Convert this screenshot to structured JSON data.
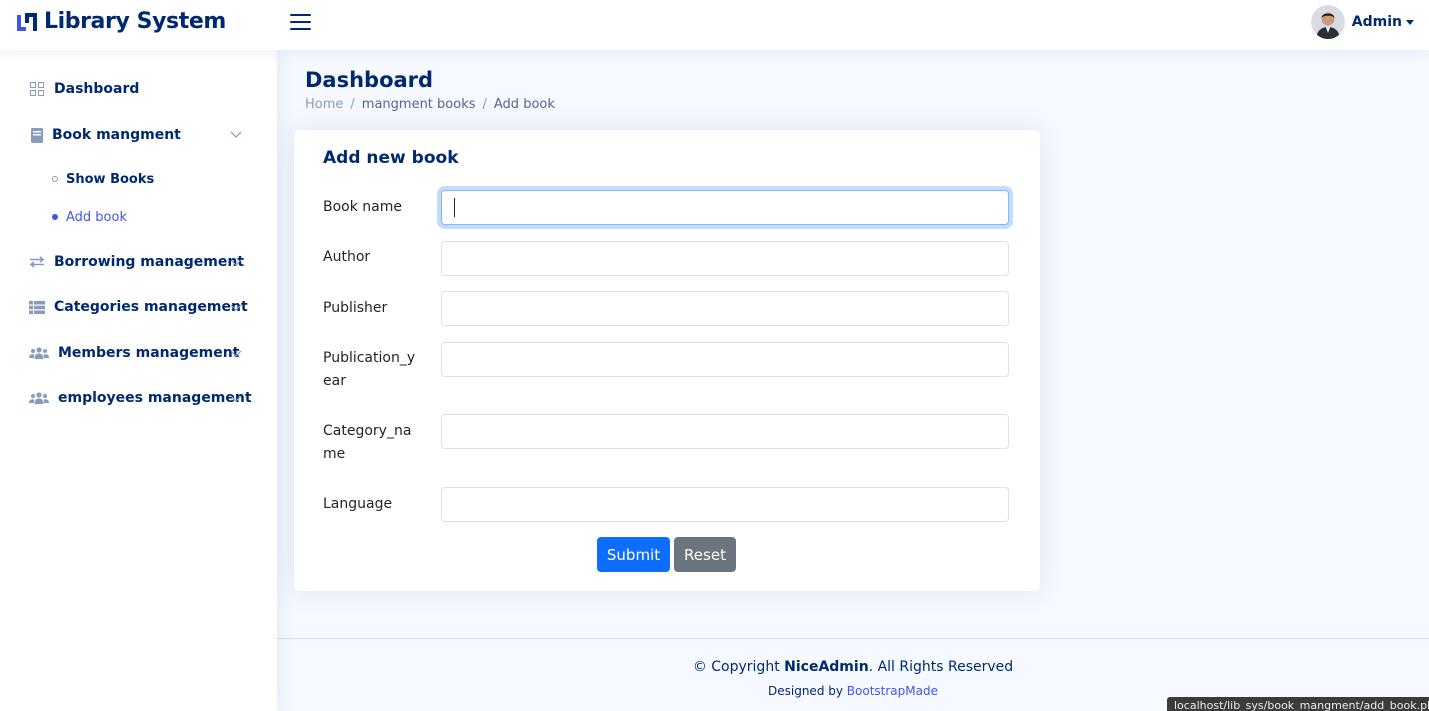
{
  "header": {
    "app_title": "Library System",
    "profile_name": "Admin"
  },
  "sidebar": {
    "items": [
      {
        "label": "Dashboard",
        "icon": "grid-icon"
      },
      {
        "label": "Book mangment",
        "icon": "book-icon"
      },
      {
        "label": "Borrowing management",
        "icon": "arrows-exchange-icon"
      },
      {
        "label": "Categories management",
        "icon": "list-icon"
      },
      {
        "label": "Members management",
        "icon": "people-icon"
      },
      {
        "label": "employees management",
        "icon": "people-icon"
      }
    ],
    "subitems": [
      {
        "label": "Show Books",
        "active": false
      },
      {
        "label": "Add book",
        "active": true
      }
    ]
  },
  "page": {
    "title": "Dashboard",
    "breadcrumb": [
      "Home",
      "mangment books",
      "Add book"
    ]
  },
  "form": {
    "title": "Add new book",
    "fields": [
      {
        "label": "Book name",
        "value": ""
      },
      {
        "label": "Author",
        "value": ""
      },
      {
        "label": "Publisher",
        "value": ""
      },
      {
        "label": "Publication_y ear",
        "value": ""
      },
      {
        "label": "Category_na me",
        "value": ""
      },
      {
        "label": "Language",
        "value": ""
      }
    ],
    "submit_label": "Submit",
    "reset_label": "Reset"
  },
  "footer": {
    "copyright_prefix": "© Copyright ",
    "brand": "NiceAdmin",
    "copyright_suffix": ". All Rights Reserved",
    "designed_by": "Designed by ",
    "designer": "BootstrapMade"
  },
  "status_url": "localhost/lib_sys/book_mangment/add_book.php#",
  "colors": {
    "navy": "#012970",
    "accent": "#4154f1",
    "primary": "#0d6efd",
    "secondary": "#6c757d",
    "page_bg": "#f6f9ff"
  }
}
